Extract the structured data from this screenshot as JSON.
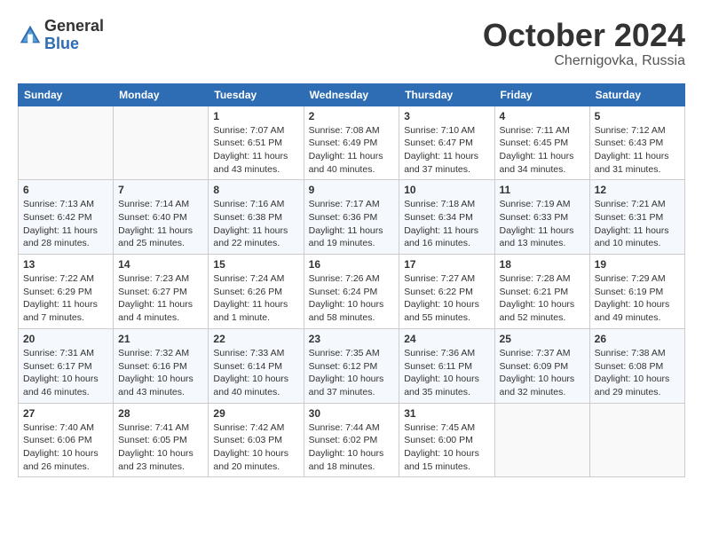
{
  "header": {
    "logo_general": "General",
    "logo_blue": "Blue",
    "month_title": "October 2024",
    "location": "Chernigovka, Russia"
  },
  "weekdays": [
    "Sunday",
    "Monday",
    "Tuesday",
    "Wednesday",
    "Thursday",
    "Friday",
    "Saturday"
  ],
  "weeks": [
    [
      {
        "day": "",
        "info": ""
      },
      {
        "day": "",
        "info": ""
      },
      {
        "day": "1",
        "info": "Sunrise: 7:07 AM\nSunset: 6:51 PM\nDaylight: 11 hours and 43 minutes."
      },
      {
        "day": "2",
        "info": "Sunrise: 7:08 AM\nSunset: 6:49 PM\nDaylight: 11 hours and 40 minutes."
      },
      {
        "day": "3",
        "info": "Sunrise: 7:10 AM\nSunset: 6:47 PM\nDaylight: 11 hours and 37 minutes."
      },
      {
        "day": "4",
        "info": "Sunrise: 7:11 AM\nSunset: 6:45 PM\nDaylight: 11 hours and 34 minutes."
      },
      {
        "day": "5",
        "info": "Sunrise: 7:12 AM\nSunset: 6:43 PM\nDaylight: 11 hours and 31 minutes."
      }
    ],
    [
      {
        "day": "6",
        "info": "Sunrise: 7:13 AM\nSunset: 6:42 PM\nDaylight: 11 hours and 28 minutes."
      },
      {
        "day": "7",
        "info": "Sunrise: 7:14 AM\nSunset: 6:40 PM\nDaylight: 11 hours and 25 minutes."
      },
      {
        "day": "8",
        "info": "Sunrise: 7:16 AM\nSunset: 6:38 PM\nDaylight: 11 hours and 22 minutes."
      },
      {
        "day": "9",
        "info": "Sunrise: 7:17 AM\nSunset: 6:36 PM\nDaylight: 11 hours and 19 minutes."
      },
      {
        "day": "10",
        "info": "Sunrise: 7:18 AM\nSunset: 6:34 PM\nDaylight: 11 hours and 16 minutes."
      },
      {
        "day": "11",
        "info": "Sunrise: 7:19 AM\nSunset: 6:33 PM\nDaylight: 11 hours and 13 minutes."
      },
      {
        "day": "12",
        "info": "Sunrise: 7:21 AM\nSunset: 6:31 PM\nDaylight: 11 hours and 10 minutes."
      }
    ],
    [
      {
        "day": "13",
        "info": "Sunrise: 7:22 AM\nSunset: 6:29 PM\nDaylight: 11 hours and 7 minutes."
      },
      {
        "day": "14",
        "info": "Sunrise: 7:23 AM\nSunset: 6:27 PM\nDaylight: 11 hours and 4 minutes."
      },
      {
        "day": "15",
        "info": "Sunrise: 7:24 AM\nSunset: 6:26 PM\nDaylight: 11 hours and 1 minute."
      },
      {
        "day": "16",
        "info": "Sunrise: 7:26 AM\nSunset: 6:24 PM\nDaylight: 10 hours and 58 minutes."
      },
      {
        "day": "17",
        "info": "Sunrise: 7:27 AM\nSunset: 6:22 PM\nDaylight: 10 hours and 55 minutes."
      },
      {
        "day": "18",
        "info": "Sunrise: 7:28 AM\nSunset: 6:21 PM\nDaylight: 10 hours and 52 minutes."
      },
      {
        "day": "19",
        "info": "Sunrise: 7:29 AM\nSunset: 6:19 PM\nDaylight: 10 hours and 49 minutes."
      }
    ],
    [
      {
        "day": "20",
        "info": "Sunrise: 7:31 AM\nSunset: 6:17 PM\nDaylight: 10 hours and 46 minutes."
      },
      {
        "day": "21",
        "info": "Sunrise: 7:32 AM\nSunset: 6:16 PM\nDaylight: 10 hours and 43 minutes."
      },
      {
        "day": "22",
        "info": "Sunrise: 7:33 AM\nSunset: 6:14 PM\nDaylight: 10 hours and 40 minutes."
      },
      {
        "day": "23",
        "info": "Sunrise: 7:35 AM\nSunset: 6:12 PM\nDaylight: 10 hours and 37 minutes."
      },
      {
        "day": "24",
        "info": "Sunrise: 7:36 AM\nSunset: 6:11 PM\nDaylight: 10 hours and 35 minutes."
      },
      {
        "day": "25",
        "info": "Sunrise: 7:37 AM\nSunset: 6:09 PM\nDaylight: 10 hours and 32 minutes."
      },
      {
        "day": "26",
        "info": "Sunrise: 7:38 AM\nSunset: 6:08 PM\nDaylight: 10 hours and 29 minutes."
      }
    ],
    [
      {
        "day": "27",
        "info": "Sunrise: 7:40 AM\nSunset: 6:06 PM\nDaylight: 10 hours and 26 minutes."
      },
      {
        "day": "28",
        "info": "Sunrise: 7:41 AM\nSunset: 6:05 PM\nDaylight: 10 hours and 23 minutes."
      },
      {
        "day": "29",
        "info": "Sunrise: 7:42 AM\nSunset: 6:03 PM\nDaylight: 10 hours and 20 minutes."
      },
      {
        "day": "30",
        "info": "Sunrise: 7:44 AM\nSunset: 6:02 PM\nDaylight: 10 hours and 18 minutes."
      },
      {
        "day": "31",
        "info": "Sunrise: 7:45 AM\nSunset: 6:00 PM\nDaylight: 10 hours and 15 minutes."
      },
      {
        "day": "",
        "info": ""
      },
      {
        "day": "",
        "info": ""
      }
    ]
  ]
}
